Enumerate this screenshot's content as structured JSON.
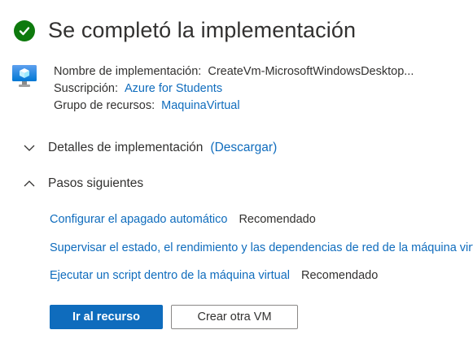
{
  "header": {
    "title": "Se completó la implementación",
    "status_icon": "success-check-icon",
    "status_color": "#0e7a0d"
  },
  "resource_icon": "virtual-machine-icon",
  "details": {
    "deployment_name_label": "Nombre de implementación:",
    "deployment_name_value": "CreateVm-MicrosoftWindowsDesktop...",
    "subscription_label": "Suscripción:",
    "subscription_value": "Azure for Students",
    "resource_group_label": "Grupo de recursos:",
    "resource_group_value": "MaquinaVirtual"
  },
  "sections": {
    "deployment_details": {
      "title": "Detalles de implementación",
      "download_link": "(Descargar)",
      "expanded": false
    },
    "next_steps": {
      "title": "Pasos siguientes",
      "expanded": true
    }
  },
  "next_steps": [
    {
      "link": "Configurar el apagado automático",
      "badge": "Recomendado"
    },
    {
      "link": "Supervisar el estado, el rendimiento y las dependencias de red de la máquina virtual",
      "badge": ""
    },
    {
      "link": "Ejecutar un script dentro de la máquina virtual",
      "badge": "Recomendado"
    }
  ],
  "buttons": {
    "go_to_resource": "Ir al recurso",
    "create_another_vm": "Crear otra VM"
  },
  "colors": {
    "link": "#0f6cbd",
    "primary_button": "#0f6cbd",
    "text": "#323130"
  }
}
